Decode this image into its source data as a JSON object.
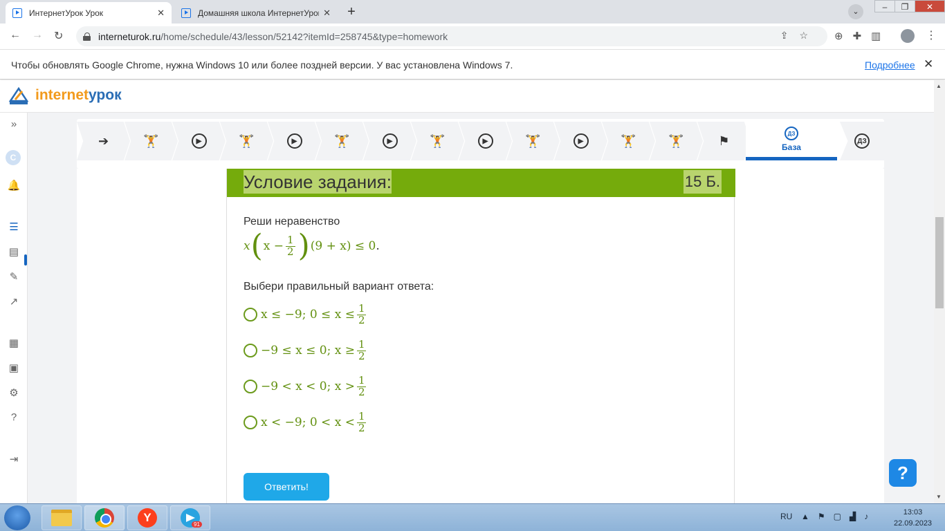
{
  "browser": {
    "tabs": [
      {
        "title": "ИнтернетУрок Урок",
        "active": true
      },
      {
        "title": "Домашняя школа ИнтернетУрок",
        "active": false
      }
    ],
    "url_host": "interneturok.ru",
    "url_path": "/home/schedule/43/lesson/52142?itemId=258745&type=homework"
  },
  "infobar": {
    "message": "Чтобы обновлять Google Chrome, нужна Windows 10 или более поздней версии. У вас установлена Windows 7.",
    "link": "Подробнее"
  },
  "site": {
    "logo_part1": "internet",
    "logo_part2": "урок"
  },
  "steps": [
    {
      "icon": "arrow-right-icon"
    },
    {
      "icon": "weightlifter-icon"
    },
    {
      "icon": "play-icon"
    },
    {
      "icon": "weightlifter-icon"
    },
    {
      "icon": "play-icon"
    },
    {
      "icon": "weightlifter-icon"
    },
    {
      "icon": "play-icon"
    },
    {
      "icon": "weightlifter-icon"
    },
    {
      "icon": "play-icon"
    },
    {
      "icon": "weightlifter-icon"
    },
    {
      "icon": "chat-play-icon"
    },
    {
      "icon": "weightlifter-icon"
    },
    {
      "icon": "weightlifter-icon"
    },
    {
      "icon": "flag-icon"
    },
    {
      "icon": "homework-icon",
      "badge": "ДЗ",
      "label": "База",
      "active": true
    },
    {
      "icon": "homework-star-icon",
      "badge": "ДЗ"
    }
  ],
  "task": {
    "title": "Условие задания:",
    "points": "15 Б.",
    "instruction": "Реши неравенство",
    "formula": {
      "pre": "x",
      "inner": "x −",
      "frac_num": "1",
      "frac_den": "2",
      "post": "(9 + x) ≤ 0",
      "tail": "."
    },
    "prompt": "Выбери правильный вариант ответа:",
    "options": [
      {
        "text": "x ≤ −9; 0 ≤ x ≤",
        "num": "1",
        "den": "2"
      },
      {
        "text": "−9 ≤ x ≤ 0; x ≥",
        "num": "1",
        "den": "2"
      },
      {
        "text": "−9 < x < 0; x >",
        "num": "1",
        "den": "2"
      },
      {
        "text": "x < −9; 0 < x <",
        "num": "1",
        "den": "2"
      }
    ],
    "submit": "Ответить!"
  },
  "help": "?",
  "taskbar": {
    "lang": "RU",
    "time": "13:03",
    "date": "22.09.2023",
    "telegram_badge": "91"
  },
  "colors": {
    "accent_green": "#75ab0c",
    "math_green": "#62900f",
    "primary_blue": "#1565c0",
    "button_blue": "#1fa8e8"
  }
}
